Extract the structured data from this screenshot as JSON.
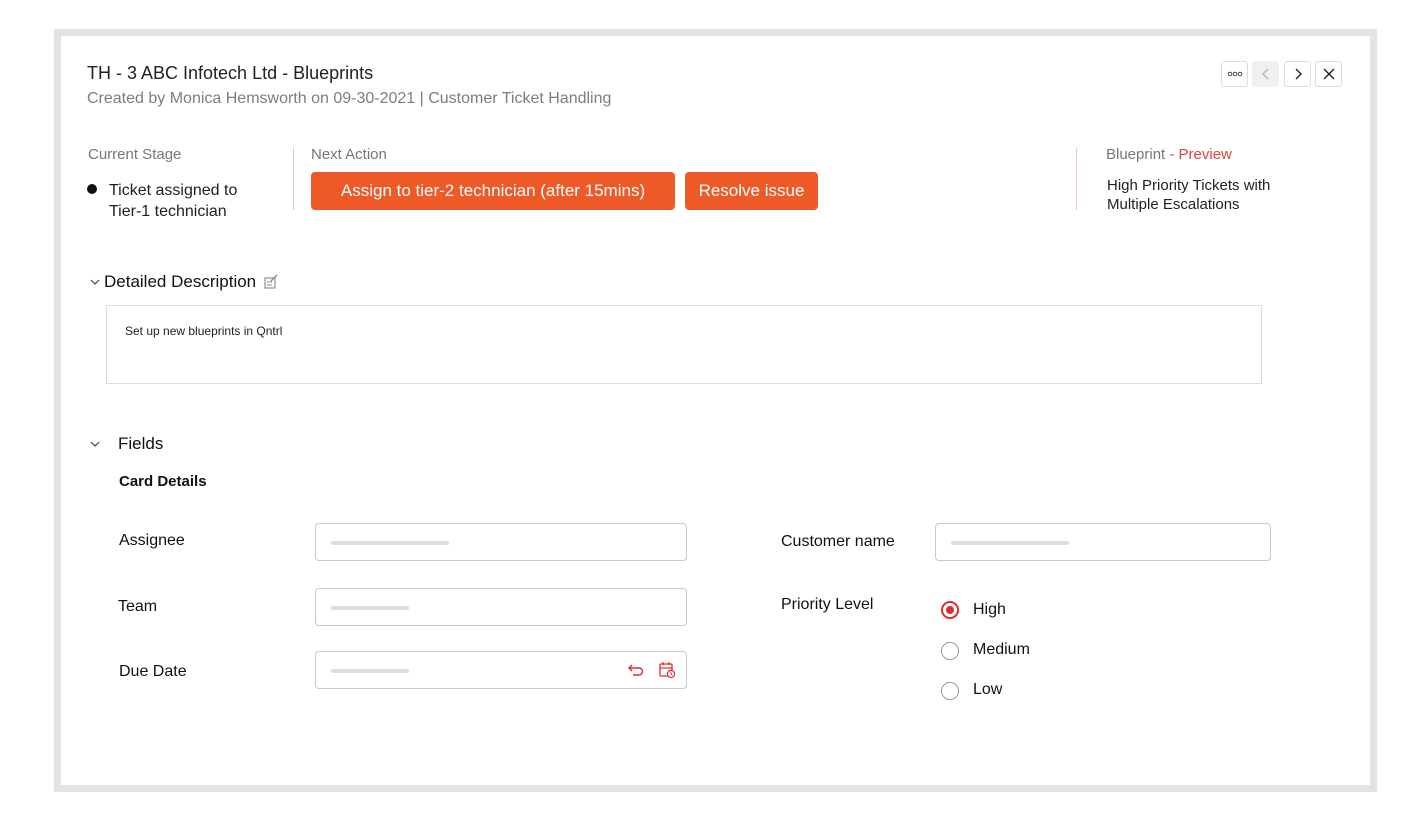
{
  "header": {
    "title": "TH - 3 ABC Infotech Ltd -  Blueprints",
    "subtitle": "Created by Monica Hemsworth on 09-30-2021 | Customer Ticket Handling"
  },
  "toolbar": {
    "more_icon": "more-horizontal-icon",
    "prev_icon": "chevron-left-icon",
    "next_icon": "chevron-right-icon",
    "close_icon": "close-icon"
  },
  "stage": {
    "current_label": "Current Stage",
    "current_line1": "Ticket assigned to",
    "current_line2": "Tier-1 technician",
    "next_label": "Next Action",
    "actions": [
      {
        "label": "Assign to tier-2 technician (after 15mins)"
      },
      {
        "label": "Resolve issue"
      }
    ],
    "blueprint_label": "Blueprint",
    "blueprint_preview": " - Preview",
    "blueprint_line1": "High Priority Tickets with",
    "blueprint_line2": "Multiple Escalations"
  },
  "description": {
    "heading": "Detailed Description",
    "text": "Set up new blueprints in Qntrl"
  },
  "fields": {
    "heading": "Fields",
    "subheading": "Card Details",
    "assignee_label": "Assignee",
    "team_label": "Team",
    "due_date_label": "Due Date",
    "customer_name_label": "Customer name",
    "priority_label": "Priority Level",
    "priority_options": [
      {
        "label": "High",
        "selected": true
      },
      {
        "label": "Medium",
        "selected": false
      },
      {
        "label": "Low",
        "selected": false
      }
    ]
  },
  "colors": {
    "accent": "#ee5a27",
    "radio_selected": "#e02c2c",
    "preview_text": "#e0453a"
  }
}
